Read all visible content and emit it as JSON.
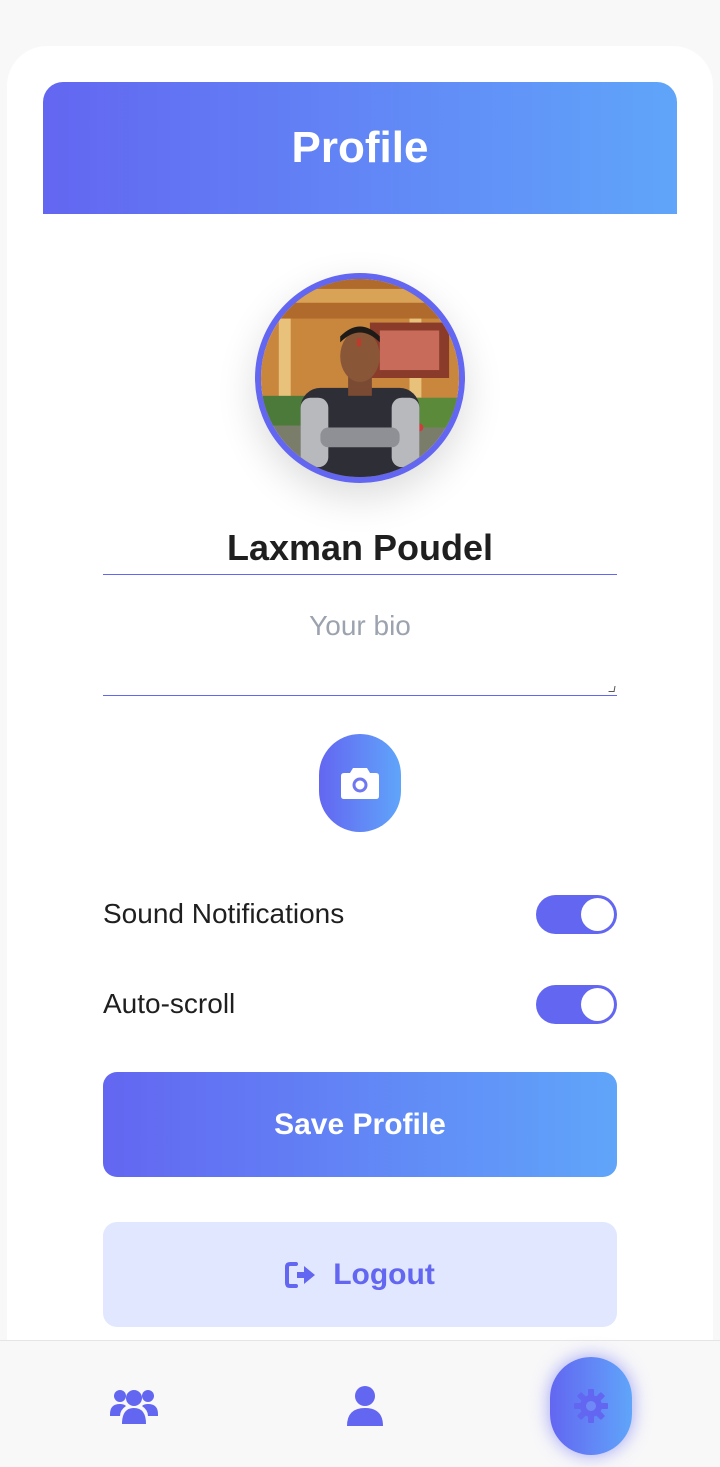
{
  "header": {
    "title": "Profile"
  },
  "profile": {
    "name": "Laxman Poudel",
    "bio_placeholder": "Your bio",
    "avatar_alt": "profile photo"
  },
  "settings": [
    {
      "label": "Sound Notifications",
      "enabled": true
    },
    {
      "label": "Auto-scroll",
      "enabled": true
    }
  ],
  "actions": {
    "save_label": "Save Profile",
    "logout_label": "Logout"
  },
  "bottom_nav": {
    "items": [
      {
        "icon": "users-icon",
        "active": false
      },
      {
        "icon": "user-icon",
        "active": false
      },
      {
        "icon": "gear-icon",
        "active": true
      }
    ]
  },
  "colors": {
    "accent": "#6366f1",
    "accent_light": "#60a5fa",
    "logout_bg": "#e0e7ff",
    "bio_placeholder": "#9ca3af"
  }
}
